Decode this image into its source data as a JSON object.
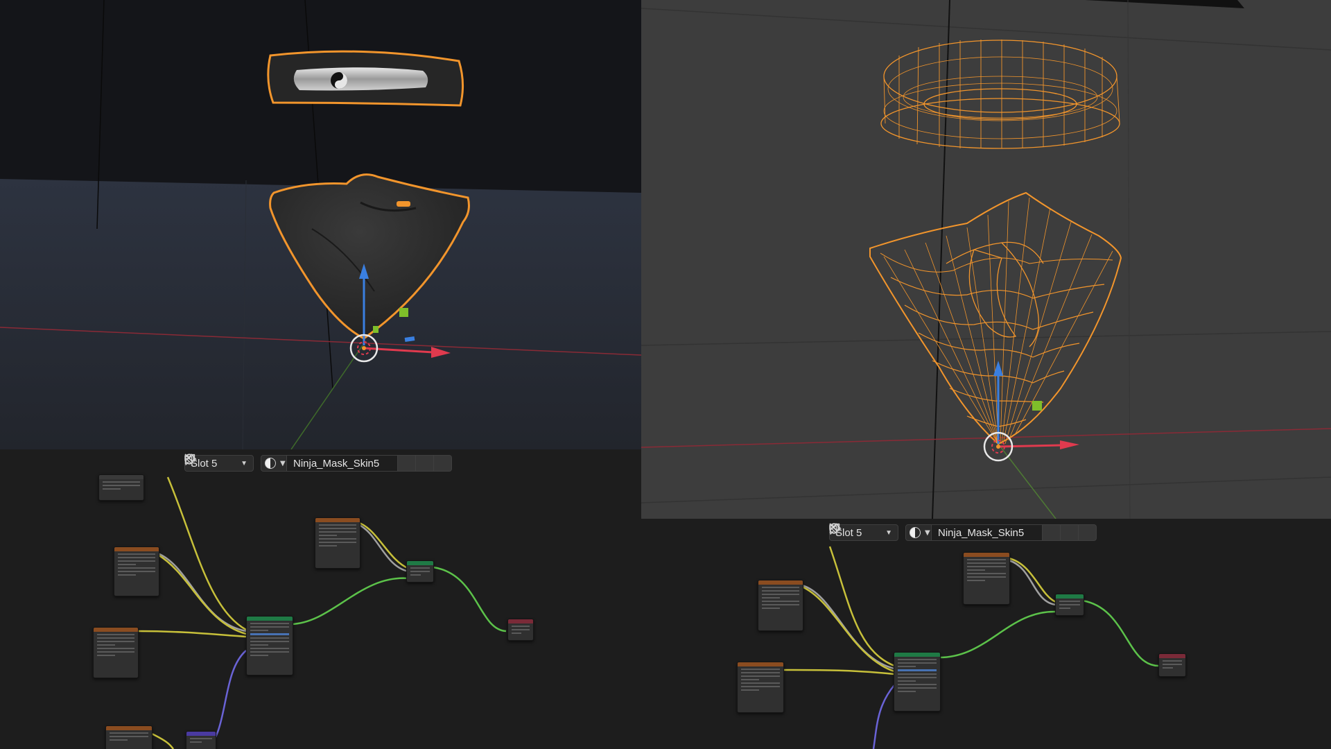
{
  "node_editor_left": {
    "slot_label": "Slot 5",
    "material_name": "Ninja_Mask_Skin5"
  },
  "node_editor_right": {
    "slot_label": "Slot 5",
    "material_name": "Ninja_Mask_Skin5"
  },
  "icons": {
    "material_type": "material-sphere-icon",
    "fake_user": "shield-icon",
    "duplicate": "duplicate-icon",
    "unlink": "close-icon",
    "pin": "pin-icon",
    "dropdown": "chevron-down-icon"
  },
  "colors": {
    "selection_orange": "#f2952c",
    "gizmo_z": "#3a7fe0",
    "gizmo_x": "#e03a4e",
    "link_yellow": "#c7c03a",
    "link_gray": "#a0a0a0",
    "link_green": "#5cc24a",
    "link_violet": "#6a63d6"
  }
}
